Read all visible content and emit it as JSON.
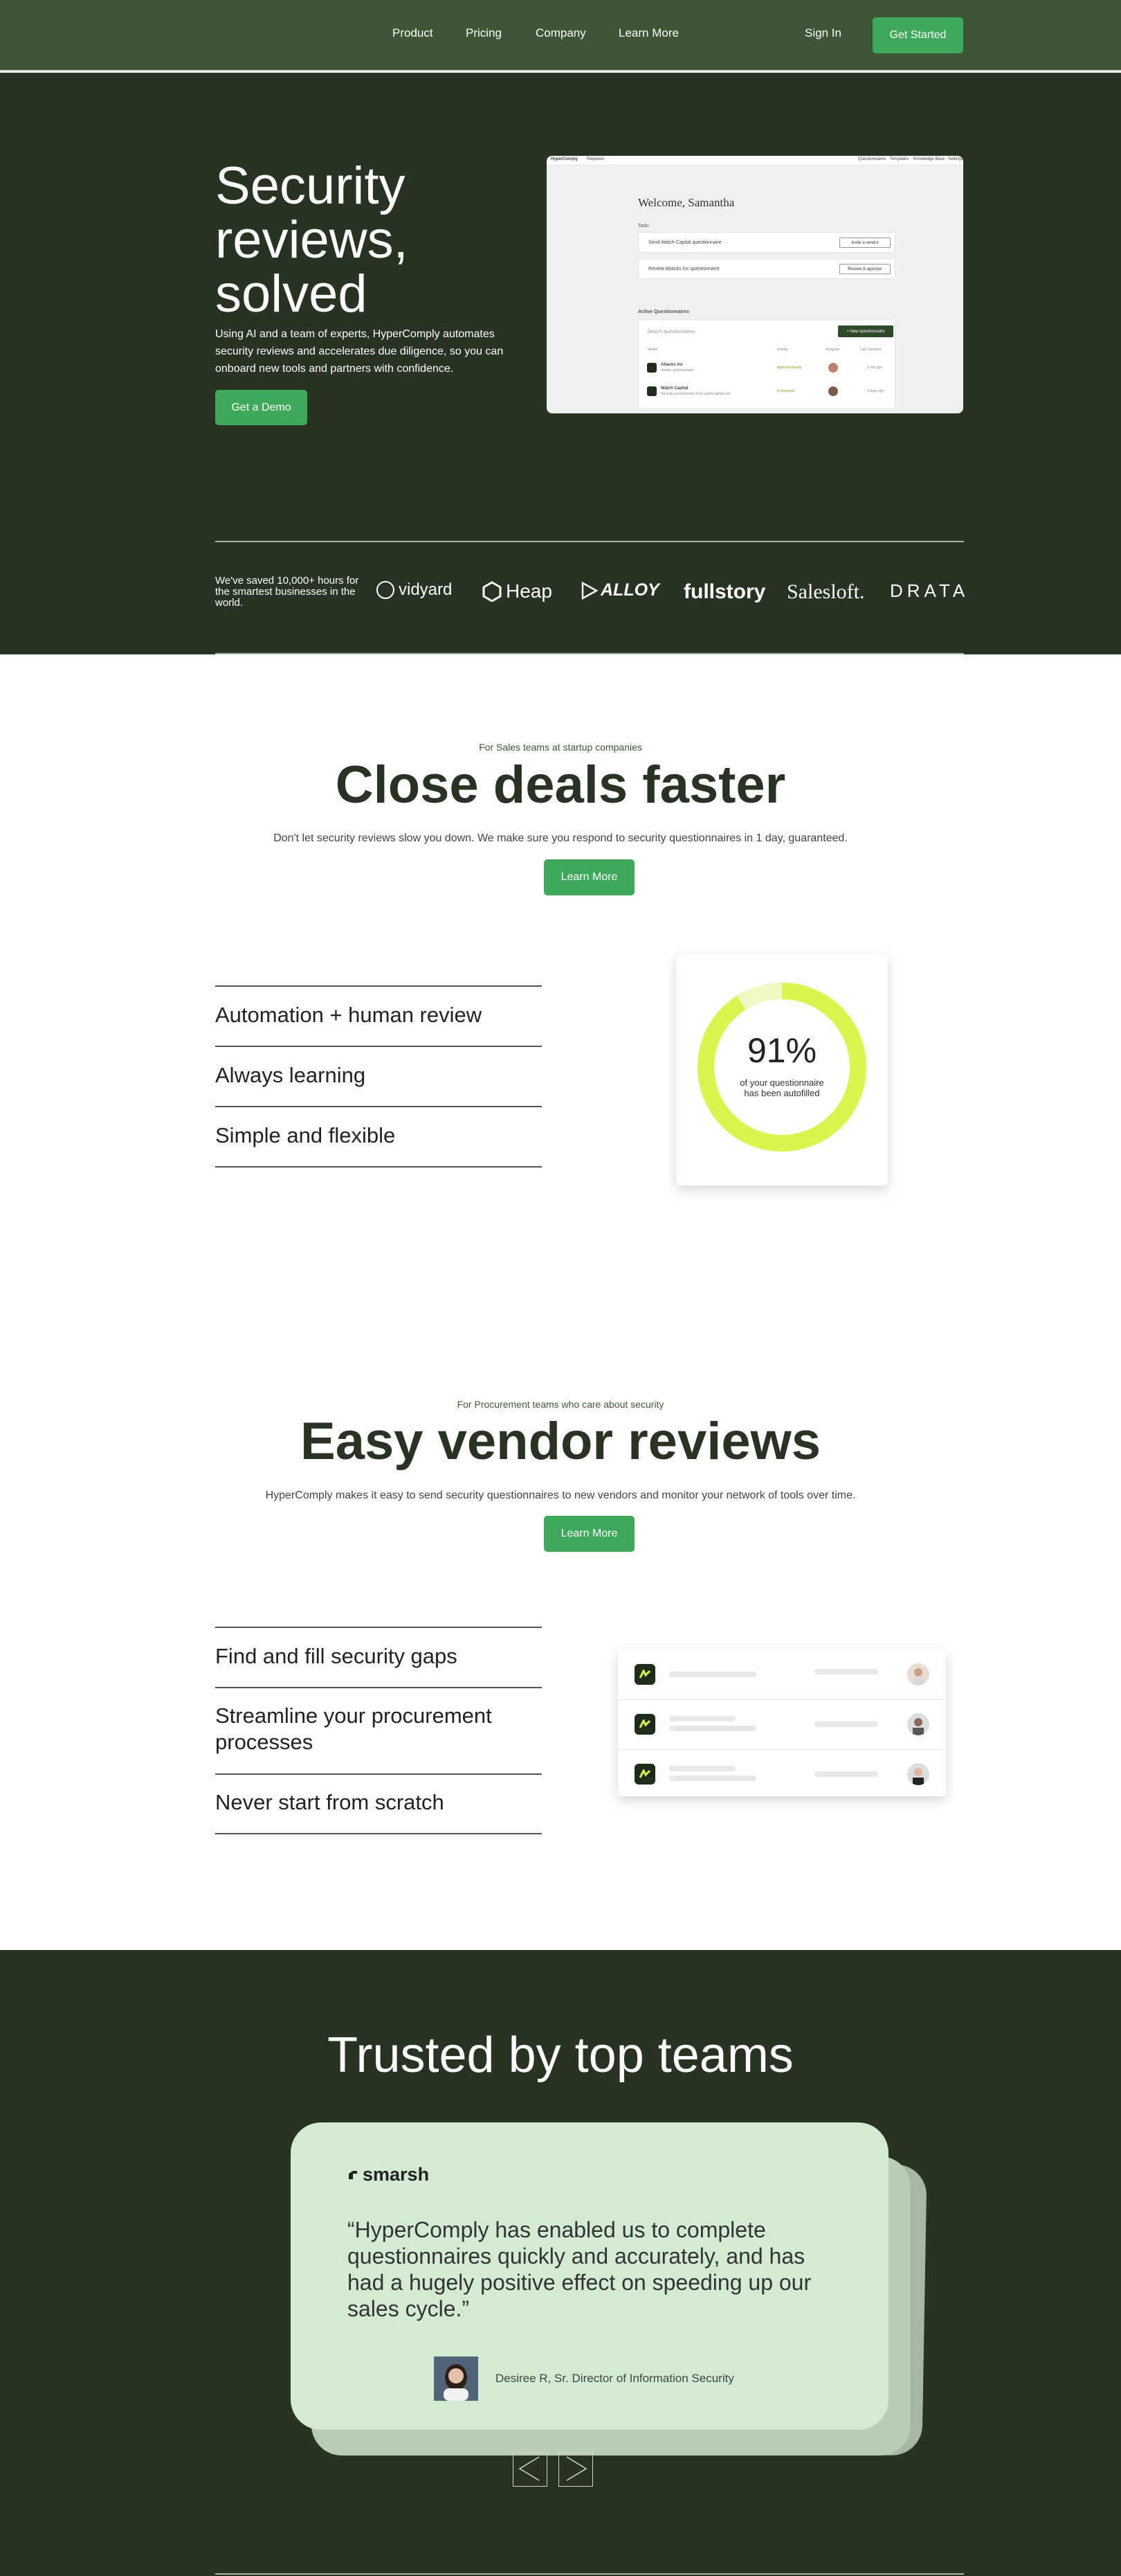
{
  "nav": {
    "links": [
      "Product",
      "Pricing",
      "Company",
      "Learn More"
    ],
    "signin": "Sign In",
    "cta": "Get Started"
  },
  "hero": {
    "title": "Security reviews, solved",
    "subtitle": "Using AI and a team of experts, HyperComply automates security reviews and accelerates due diligence, so you can onboard new tools and partners with confidence.",
    "cta": "Get a Demo",
    "saved": "We've saved 10,000+ hours for the smartest businesses in the world.",
    "logos": [
      "vidyard",
      "Heap",
      "ALLOY",
      "fullstory",
      "Salesloft.",
      "DRATA"
    ]
  },
  "dashboard": {
    "brand": "HyperComply",
    "brand_menu": "Requests",
    "menu": [
      "Questionnaires",
      "Templates",
      "Knowledge Base",
      "Settings"
    ],
    "welcome": "Welcome, Samantha",
    "todo_label": "Todo",
    "todos": [
      {
        "text": "Send Watch Capital questionnaire",
        "button": "Invite a vendor"
      },
      {
        "text": "Review Attacks Inc questionnaire",
        "button": "Review & approve"
      }
    ],
    "active_label": "Active Questionnaires",
    "search_placeholder": "Search questionnaires",
    "new_button": "+ New questionnaire",
    "columns": [
      "Vendor",
      "Activity",
      "Assignee",
      "Last Updated"
    ],
    "rows": [
      {
        "name": "Attacks Inc",
        "sub": "Vendor questionnaire",
        "status": "Approval Ready",
        "updated": "1 min ago"
      },
      {
        "name": "Watch Capital",
        "sub": "Security questionnaire from watchcapital.com",
        "status": "In progress",
        "updated": "3 days ago"
      }
    ]
  },
  "sales": {
    "eyebrow": "For Sales teams at startup companies",
    "title": "Close deals faster",
    "lead": "Don't let security reviews slow you down. We make sure you respond to security questionnaires in 1 day, guaranteed.",
    "cta": "Learn More",
    "features": [
      "Automation + human review",
      "Always learning",
      "Simple and flexible"
    ],
    "stat_value": "91%",
    "stat_label_line1": "of your questionnaire",
    "stat_label_line2": "has been autofilled",
    "stat_fraction": 0.91,
    "ring_color": "#dcf44f"
  },
  "vendor": {
    "eyebrow": "For Procurement teams who care about security",
    "title": "Easy vendor reviews",
    "lead": "HyperComply makes it easy to send security questionnaires to new vendors and monitor your network of tools over time.",
    "cta": "Learn More",
    "features": [
      "Find and fill security gaps",
      "Streamline your procurement processes",
      "Never start from scratch"
    ]
  },
  "trusted": {
    "title": "Trusted by top teams",
    "logo": "smarsh",
    "quote": "“HyperComply has enabled us to complete questionnaires quickly and accurately, and has had a hugely positive effect on speeding up our sales cycle.”",
    "author": "Desiree R, Sr. Director of Information Security"
  },
  "colors": {
    "nav_bg": "#3c5636",
    "dark_bg": "#283323",
    "accent": "#3ea95b",
    "quote_bg": "#d3ead3"
  }
}
